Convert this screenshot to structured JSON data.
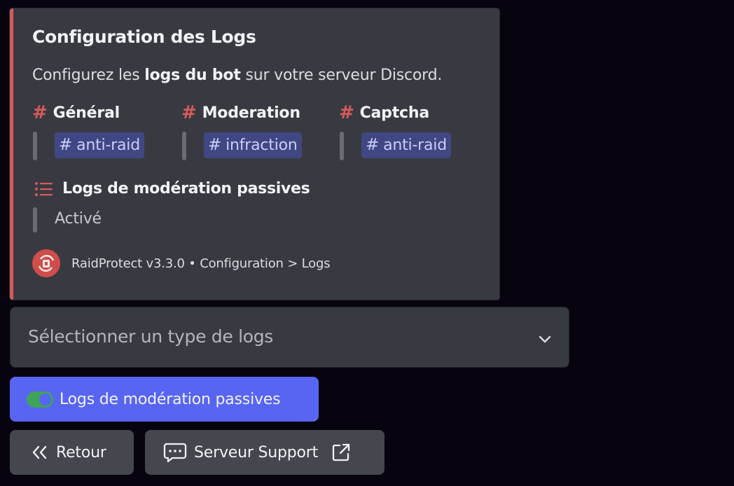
{
  "embed": {
    "accent_color": "#d65a5c",
    "title": "Configuration des Logs",
    "description": {
      "prefix": "Configurez les ",
      "bold": "logs du bot",
      "suffix": " sur votre serveur Discord."
    },
    "fields": [
      {
        "icon": "hash-icon",
        "name": "Général",
        "channel_prefix": "#",
        "channel": "anti-raid"
      },
      {
        "icon": "hash-icon",
        "name": "Moderation",
        "channel_prefix": "#",
        "channel": "infraction"
      },
      {
        "icon": "hash-icon",
        "name": "Captcha",
        "channel_prefix": "#",
        "channel": "anti-raid"
      }
    ],
    "passive": {
      "icon": "list-icon",
      "name": "Logs de modération passives",
      "value": "Activé"
    },
    "footer": {
      "icon": "raidprotect-avatar",
      "text": "RaidProtect v3.3.0 • Configuration > Logs"
    }
  },
  "select": {
    "placeholder": "Sélectionner un type de logs",
    "icon": "chevron-down-icon"
  },
  "buttons": {
    "passive_toggle": {
      "label": "Logs de modération passives",
      "icon": "toggle-on-icon",
      "color": "#5865f2"
    },
    "back": {
      "label": "Retour",
      "icon": "double-chevron-left-icon"
    },
    "support": {
      "label": "Serveur Support",
      "icon": "chat-bubble-icon",
      "trailing_icon": "external-link-icon"
    }
  }
}
